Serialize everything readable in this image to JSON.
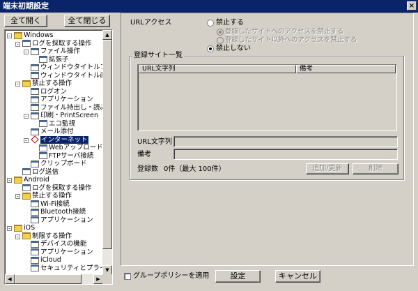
{
  "window": {
    "title": "端末初期設定",
    "close_symbol": "×"
  },
  "toolbar": {
    "expand_all": "全て開く",
    "collapse_all": "全て閉じる"
  },
  "tree": {
    "items": [
      {
        "label": "Windows",
        "icon": "folder-icon",
        "level": 0,
        "expander": "-"
      },
      {
        "label": "ログを採取する操作",
        "icon": "page-icon",
        "level": 1,
        "expander": "-"
      },
      {
        "label": "ファイル操作",
        "icon": "page-icon",
        "level": 2,
        "expander": "-"
      },
      {
        "label": "拡張子",
        "icon": "page-icon",
        "level": 3,
        "expander": ""
      },
      {
        "label": "ウィンドウタイトルフィル",
        "icon": "page-icon",
        "level": 2,
        "expander": ""
      },
      {
        "label": "ウィンドウタイトル画面キ",
        "icon": "page-icon",
        "level": 2,
        "expander": ""
      },
      {
        "label": "禁止する操作",
        "icon": "folder-icon",
        "level": 1,
        "expander": "-"
      },
      {
        "label": "ログオン",
        "icon": "page-icon",
        "level": 2,
        "expander": ""
      },
      {
        "label": "アプリケーション",
        "icon": "page-icon",
        "level": 2,
        "expander": ""
      },
      {
        "label": "ファイル持出し・読み込",
        "icon": "page-icon",
        "level": 2,
        "expander": ""
      },
      {
        "label": "印刷・PrintScreen",
        "icon": "page-icon",
        "level": 2,
        "expander": "-"
      },
      {
        "label": "エコ監視",
        "icon": "page-icon",
        "level": 3,
        "expander": ""
      },
      {
        "label": "メール添付",
        "icon": "page-icon",
        "level": 2,
        "expander": ""
      },
      {
        "label": "インターネット",
        "icon": "diamond-icon",
        "level": 2,
        "expander": "-",
        "selected": true
      },
      {
        "label": "Webアップロード・ダ",
        "icon": "page-icon",
        "level": 3,
        "expander": ""
      },
      {
        "label": "FTPサーバ接続",
        "icon": "page-icon",
        "level": 3,
        "expander": ""
      },
      {
        "label": "クリップボード",
        "icon": "page-icon",
        "level": 2,
        "expander": ""
      },
      {
        "label": "ログ送信",
        "icon": "page-icon",
        "level": 1,
        "expander": ""
      },
      {
        "label": "Android",
        "icon": "folder-icon",
        "level": 0,
        "expander": "-"
      },
      {
        "label": "ログを採取する操作",
        "icon": "page-icon",
        "level": 1,
        "expander": ""
      },
      {
        "label": "禁止する操作",
        "icon": "folder-icon",
        "level": 1,
        "expander": "-"
      },
      {
        "label": "Wi-Fi接続",
        "icon": "page-icon",
        "level": 2,
        "expander": ""
      },
      {
        "label": "Bluetooth接続",
        "icon": "page-icon",
        "level": 2,
        "expander": ""
      },
      {
        "label": "アプリケーション",
        "icon": "page-icon",
        "level": 2,
        "expander": ""
      },
      {
        "label": "iOS",
        "icon": "folder-icon",
        "level": 0,
        "expander": "-"
      },
      {
        "label": "制限する操作",
        "icon": "folder-icon",
        "level": 1,
        "expander": "-"
      },
      {
        "label": "デバイスの機能",
        "icon": "page-icon",
        "level": 2,
        "expander": ""
      },
      {
        "label": "アプリケーション",
        "icon": "page-icon",
        "level": 2,
        "expander": ""
      },
      {
        "label": "iCloud",
        "icon": "page-icon",
        "level": 2,
        "expander": ""
      },
      {
        "label": "セキュリティとプライバシ",
        "icon": "page-icon",
        "level": 2,
        "expander": ""
      }
    ]
  },
  "url_access": {
    "label": "URLアクセス",
    "prohibit": "禁止する",
    "prohibit_registered": "登録したサイトへのアクセスを禁止する",
    "prohibit_unregistered": "登録したサイト以外へのアクセスを禁止する",
    "allow": "禁止しない"
  },
  "site_list": {
    "group_title": "登録サイト一覧",
    "col_url": "URL文字列",
    "col_note": "備考",
    "url_label": "URL文字列",
    "note_label": "備考",
    "count_label": "登録数",
    "count_value": "0件（最大 100件）",
    "add_update": "追加/更新",
    "delete": "削除"
  },
  "footer": {
    "group_policy": "グループポリシーを適用",
    "ok": "設定",
    "cancel": "キャンセル"
  }
}
